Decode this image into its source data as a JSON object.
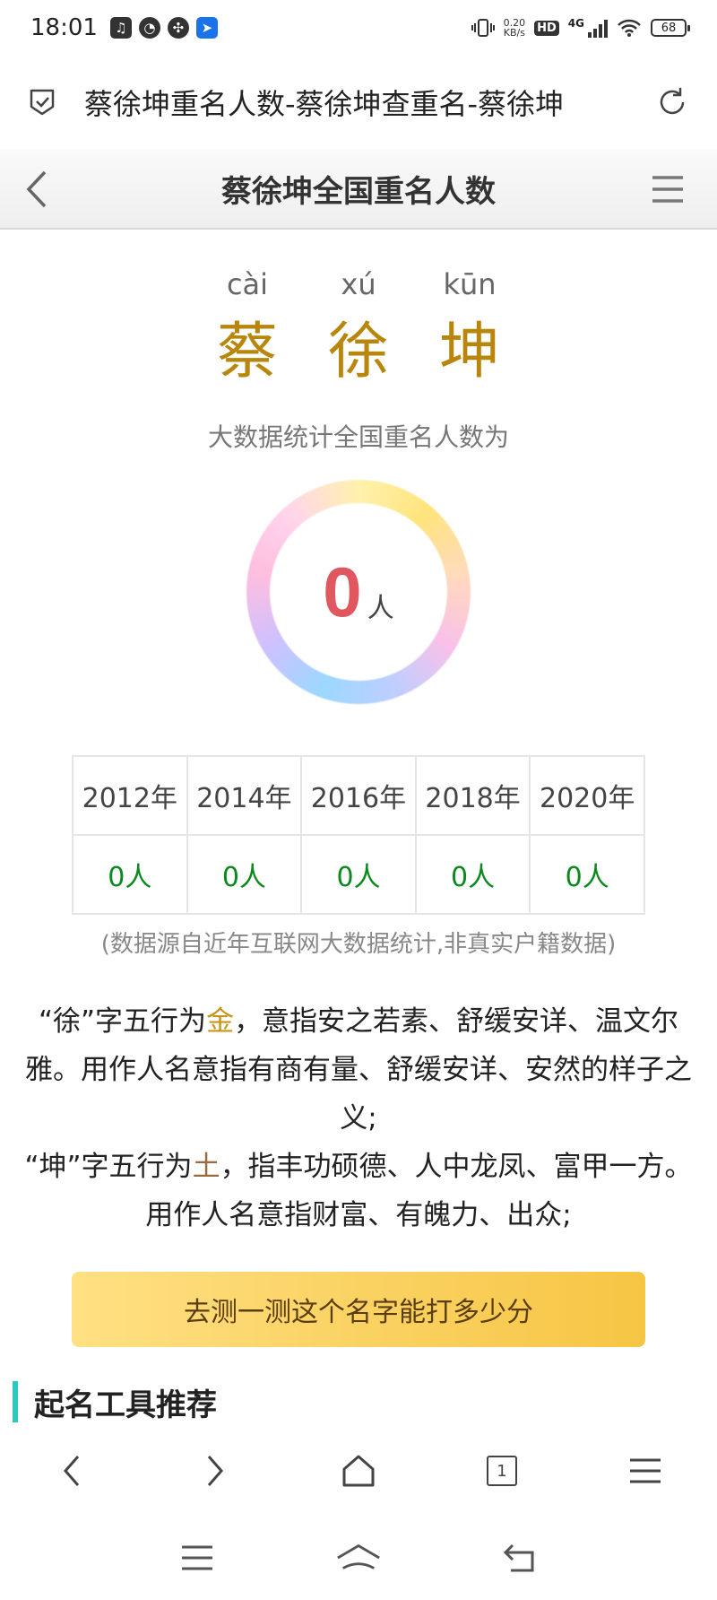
{
  "status_bar": {
    "time": "18:01",
    "net_speed_value": "0.20",
    "net_speed_unit": "KB/s",
    "hd_label": "HD",
    "network_type": "4G",
    "battery_level": "68"
  },
  "address_bar": {
    "url_title": "蔡徐坤重名人数-蔡徐坤查重名-蔡徐坤"
  },
  "page_header": {
    "title": "蔡徐坤全国重名人数"
  },
  "name": {
    "chars": [
      {
        "pinyin": "cài",
        "hanzi": "蔡"
      },
      {
        "pinyin": "xú",
        "hanzi": "徐"
      },
      {
        "pinyin": "kūn",
        "hanzi": "坤"
      }
    ]
  },
  "stats": {
    "caption": "大数据统计全国重名人数为",
    "count": "0",
    "unit": "人",
    "years": [
      "2012年",
      "2014年",
      "2016年",
      "2018年",
      "2020年"
    ],
    "year_counts": [
      "0人",
      "0人",
      "0人",
      "0人",
      "0人"
    ],
    "source_note": "(数据源自近年互联网大数据统计,非真实户籍数据)"
  },
  "description": {
    "p1_prefix": "“徐”字五行为",
    "p1_element": "金",
    "p1_rest": "，意指安之若素、舒缓安详、温文尔雅。用作人名意指有商有量、舒缓安详、安然的样子之义;",
    "p2_prefix": "“坤”字五行为",
    "p2_element": "土",
    "p2_rest": "，指丰功硕德、人中龙凤、富甲一方。用作人名意指财富、有魄力、出众;",
    "colors": {
      "jin": "#c8951a",
      "tu": "#9a6b3b"
    }
  },
  "cta": {
    "label": "去测一测这个名字能打多少分"
  },
  "section": {
    "title": "起名工具推荐"
  },
  "browser_toolbar": {
    "tab_count": "1"
  },
  "colors": {
    "count": "#e0575f",
    "name": "#b8860b",
    "year_count": "#0a8a1c",
    "accent": "#2ec7c0"
  }
}
